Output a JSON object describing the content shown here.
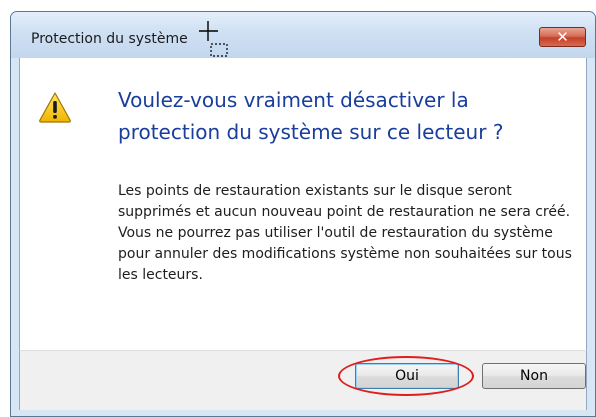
{
  "dialog": {
    "title": "Protection du système",
    "close_glyph": "✕",
    "headline": "Voulez-vous vraiment désactiver la protection du système sur ce lecteur ?",
    "body": "Les points de restauration existants sur le disque seront supprimés et aucun nouveau point de restauration ne sera créé. Vous ne pourrez pas utiliser l'outil de restauration du système pour annuler des modifications système non souhaitées sur tous les lecteurs.",
    "icon": "warning-icon"
  },
  "buttons": {
    "yes_label": "Oui",
    "no_label": "Non"
  },
  "annotation": {
    "highlight_color": "#e01d1d",
    "highlighted": "Oui"
  },
  "colors": {
    "headline": "#1a3e9c",
    "close_button": "#c4412a",
    "warning_fill": "#f5c400"
  }
}
